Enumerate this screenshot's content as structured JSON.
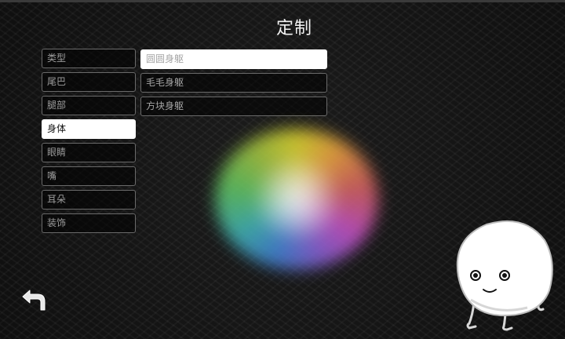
{
  "header": {
    "title": "定制"
  },
  "categories": [
    {
      "label": "类型",
      "selected": false
    },
    {
      "label": "尾巴",
      "selected": false
    },
    {
      "label": "腿部",
      "selected": false
    },
    {
      "label": "身体",
      "selected": true
    },
    {
      "label": "眼睛",
      "selected": false
    },
    {
      "label": "嘴",
      "selected": false
    },
    {
      "label": "耳朵",
      "selected": false
    },
    {
      "label": "装饰",
      "selected": false
    }
  ],
  "options": [
    {
      "label": "圆圆身躯",
      "selected": true
    },
    {
      "label": "毛毛身躯",
      "selected": false
    },
    {
      "label": "方块身躯",
      "selected": false
    }
  ],
  "icons": {
    "back": "back-arrow-icon",
    "picker": "color-wheel",
    "mascot": "round-creature"
  },
  "colors": {
    "selected_bg": "#ffffff",
    "item_border": "#6a6a6a",
    "background": "#151515"
  }
}
